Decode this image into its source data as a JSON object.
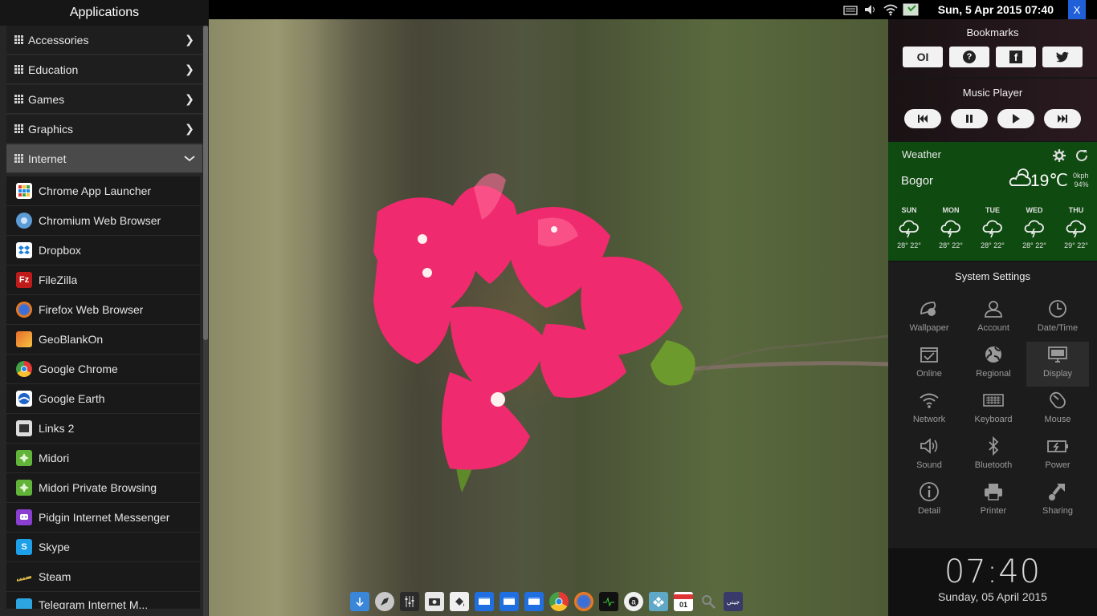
{
  "menu": {
    "title": "Applications",
    "categories": [
      {
        "label": "Accessories",
        "chevron": "❯"
      },
      {
        "label": "Education",
        "chevron": "❯"
      },
      {
        "label": "Games",
        "chevron": "❯"
      },
      {
        "label": "Graphics",
        "chevron": "❯"
      },
      {
        "label": "Internet",
        "chevron": "❮"
      }
    ],
    "apps": [
      {
        "label": "Chrome App Launcher",
        "icon": "chrome-app-launcher-icon"
      },
      {
        "label": "Chromium Web Browser",
        "icon": "chromium-icon"
      },
      {
        "label": "Dropbox",
        "icon": "dropbox-icon"
      },
      {
        "label": "FileZilla",
        "icon": "filezilla-icon"
      },
      {
        "label": "Firefox Web Browser",
        "icon": "firefox-icon"
      },
      {
        "label": "GeoBlankOn",
        "icon": "geoblankon-icon"
      },
      {
        "label": "Google Chrome",
        "icon": "chrome-icon"
      },
      {
        "label": "Google Earth",
        "icon": "google-earth-icon"
      },
      {
        "label": "Links 2",
        "icon": "links-icon"
      },
      {
        "label": "Midori",
        "icon": "midori-icon"
      },
      {
        "label": "Midori Private Browsing",
        "icon": "midori-private-icon"
      },
      {
        "label": "Pidgin Internet Messenger",
        "icon": "pidgin-icon"
      },
      {
        "label": "Skype",
        "icon": "skype-icon"
      },
      {
        "label": "Steam",
        "icon": "steam-icon"
      },
      {
        "label": "Telegram Internet M...",
        "icon": "telegram-icon"
      }
    ]
  },
  "topbar": {
    "datetime": "Sun,  5 Apr 2015 07:40",
    "close_label": "X",
    "icons": [
      "keyboard-icon",
      "volume-icon",
      "wifi-icon",
      "download-icon"
    ]
  },
  "bookmarks": {
    "title": "Bookmarks",
    "items": [
      {
        "label": "OI",
        "icon": "blankon-icon"
      },
      {
        "label": "?",
        "icon": "help-icon"
      },
      {
        "label": "f",
        "icon": "facebook-icon"
      },
      {
        "label": "🐦",
        "icon": "twitter-icon"
      }
    ]
  },
  "music": {
    "title": "Music Player",
    "controls": [
      {
        "label": "⏮",
        "icon": "previous-icon"
      },
      {
        "label": "⏸",
        "icon": "pause-icon"
      },
      {
        "label": "▶",
        "icon": "play-icon"
      },
      {
        "label": "⏭",
        "icon": "next-icon"
      }
    ]
  },
  "weather": {
    "title": "Weather",
    "city": "Bogor",
    "temp": "19℃",
    "wind": "0kph",
    "humidity": "94%",
    "days": [
      {
        "day": "SUN",
        "temps": "28°  22°"
      },
      {
        "day": "MON",
        "temps": "28°  22°"
      },
      {
        "day": "TUE",
        "temps": "28°  22°"
      },
      {
        "day": "WED",
        "temps": "28°  22°"
      },
      {
        "day": "THU",
        "temps": "29°  22°"
      }
    ]
  },
  "settings": {
    "title": "System Settings",
    "items": [
      {
        "label": "Wallpaper",
        "icon": "wallpaper-icon"
      },
      {
        "label": "Account",
        "icon": "account-icon"
      },
      {
        "label": "Date/Time",
        "icon": "clock-icon"
      },
      {
        "label": "Online",
        "icon": "online-icon"
      },
      {
        "label": "Regional",
        "icon": "globe-icon"
      },
      {
        "label": "Display",
        "icon": "display-icon"
      },
      {
        "label": "Network",
        "icon": "network-icon"
      },
      {
        "label": "Keyboard",
        "icon": "keyboard-icon"
      },
      {
        "label": "Mouse",
        "icon": "mouse-icon"
      },
      {
        "label": "Sound",
        "icon": "sound-icon"
      },
      {
        "label": "Bluetooth",
        "icon": "bluetooth-icon"
      },
      {
        "label": "Power",
        "icon": "power-icon"
      },
      {
        "label": "Detail",
        "icon": "info-icon"
      },
      {
        "label": "Printer",
        "icon": "printer-icon"
      },
      {
        "label": "Sharing",
        "icon": "sharing-icon"
      }
    ]
  },
  "clock": {
    "time": "07:40",
    "date": "Sunday, 05 April 2015"
  },
  "dock": {
    "items": [
      {
        "icon": "home-icon"
      },
      {
        "icon": "launcher-icon"
      },
      {
        "icon": "mixer-icon"
      },
      {
        "icon": "screenshot-icon"
      },
      {
        "icon": "paint-icon"
      },
      {
        "icon": "window-icon"
      },
      {
        "icon": "window-icon"
      },
      {
        "icon": "window-icon"
      },
      {
        "icon": "chrome-icon"
      },
      {
        "icon": "firefox-icon"
      },
      {
        "icon": "system-monitor-icon"
      },
      {
        "icon": "amazon-icon"
      },
      {
        "icon": "games-icon"
      },
      {
        "label": "01",
        "icon": "calendar-icon"
      },
      {
        "icon": "search-icon"
      },
      {
        "label": "جيني",
        "icon": "app-icon"
      }
    ]
  }
}
